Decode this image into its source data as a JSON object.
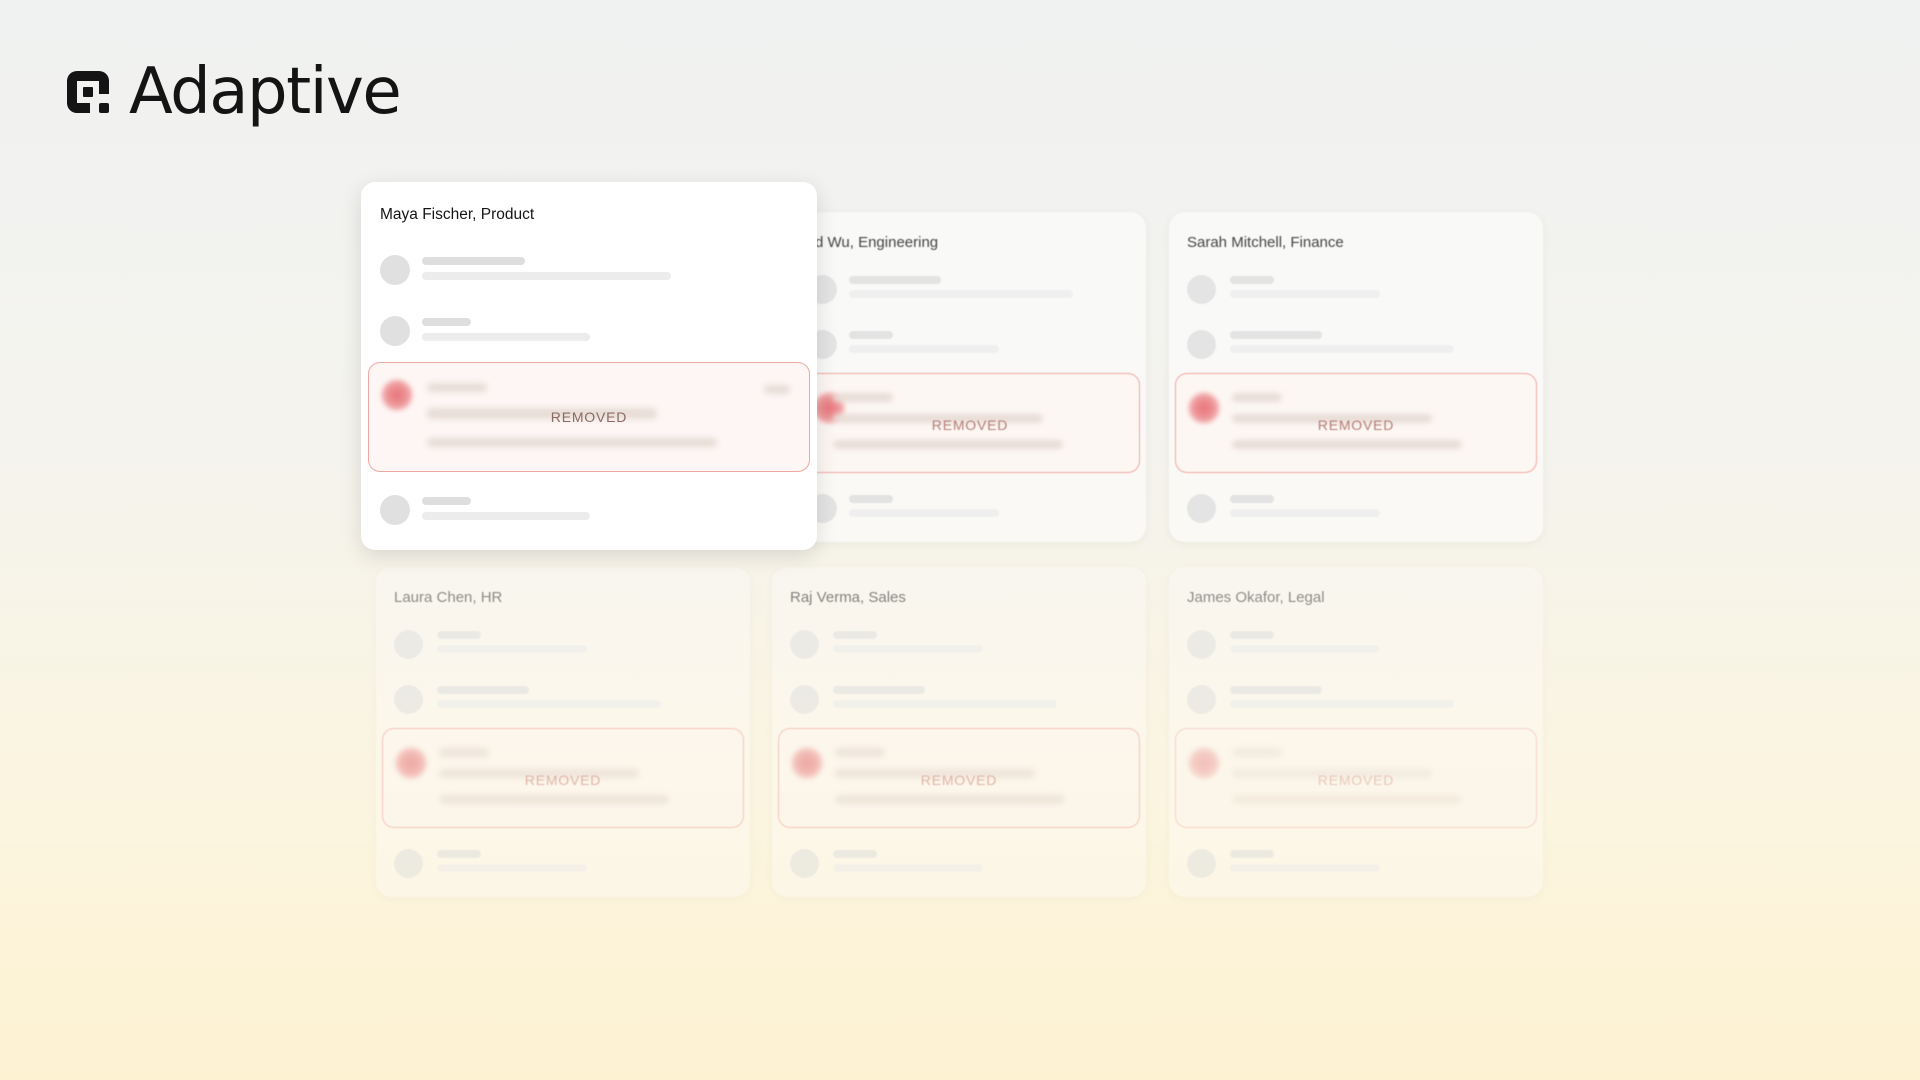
{
  "brand": {
    "name": "Adaptive",
    "logo_icon": "adaptive-logo-icon"
  },
  "cards": [
    {
      "id": "engineering",
      "title": "d Wu, Engineering",
      "removed_label": "REMOVED"
    },
    {
      "id": "finance",
      "title": "Sarah Mitchell, Finance",
      "removed_label": "REMOVED"
    },
    {
      "id": "hr",
      "title": "Laura Chen, HR",
      "removed_label": "REMOVED"
    },
    {
      "id": "sales",
      "title": "Raj Verma, Sales",
      "removed_label": "REMOVED"
    },
    {
      "id": "legal",
      "title": "James Okafor, Legal",
      "removed_label": "REMOVED"
    },
    {
      "id": "product",
      "title": "Maya Fischer, Product",
      "removed_label": "REMOVED"
    }
  ],
  "colors": {
    "removed_border": "#f0a7a2",
    "removed_dot": "#e8737a",
    "text": "#151515"
  }
}
